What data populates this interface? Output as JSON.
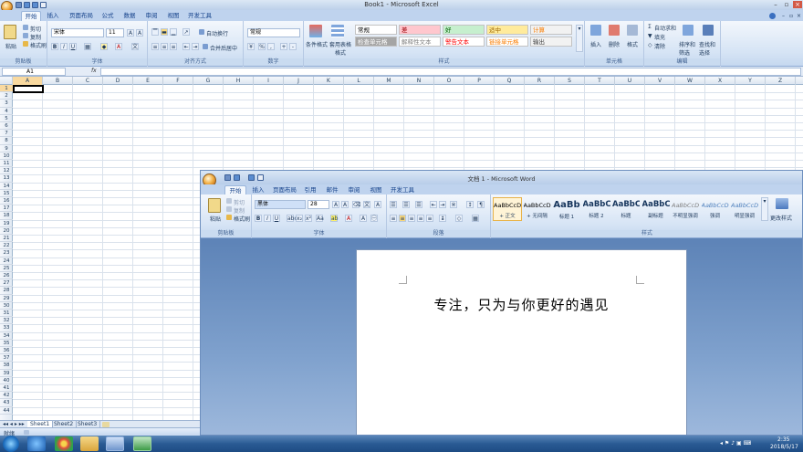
{
  "excel": {
    "title": "Book1 - Microsoft Excel",
    "tabs": [
      "开始",
      "插入",
      "页面布局",
      "公式",
      "数据",
      "审阅",
      "视图",
      "开发工具"
    ],
    "active_tab": "开始",
    "clipboard": {
      "paste": "粘贴",
      "cut": "剪切",
      "copy": "复制",
      "format_painter": "格式刷",
      "label": "剪贴板"
    },
    "font": {
      "name": "宋体",
      "size": "11",
      "label": "字体"
    },
    "alignment": {
      "wrap": "自动换行",
      "merge": "合并后居中",
      "label": "对齐方式"
    },
    "number": {
      "format": "常规",
      "label": "数字"
    },
    "styles": {
      "conditional": "条件格式",
      "table": "套用表格格式",
      "cells": [
        {
          "text": "常规",
          "bg": "#ffffff",
          "fg": "#000000"
        },
        {
          "text": "差",
          "bg": "#ffc7ce",
          "fg": "#9c0006"
        },
        {
          "text": "好",
          "bg": "#c6efce",
          "fg": "#006100"
        },
        {
          "text": "适中",
          "bg": "#ffeb9c",
          "fg": "#9c6500"
        },
        {
          "text": "计算",
          "bg": "#f2f2f2",
          "fg": "#fa7d00"
        },
        {
          "text": "检查单元格",
          "bg": "#a5a5a5",
          "fg": "#ffffff"
        },
        {
          "text": "解释性文本",
          "bg": "#ffffff",
          "fg": "#7f7f7f"
        },
        {
          "text": "警告文本",
          "bg": "#ffffff",
          "fg": "#ff0000"
        },
        {
          "text": "链接单元格",
          "bg": "#ffffff",
          "fg": "#fa7d00"
        },
        {
          "text": "输出",
          "bg": "#f2f2f2",
          "fg": "#3f3f3f"
        }
      ],
      "label": "样式"
    },
    "cells_group": {
      "insert": "插入",
      "delete": "删除",
      "format": "格式",
      "label": "单元格"
    },
    "editing": {
      "autosum": "自动求和",
      "fill": "填充",
      "clear": "清除",
      "sort": "排序和筛选",
      "find": "查找和选择",
      "label": "编辑"
    },
    "name_box": "A1",
    "fx": "fx",
    "columns": [
      "A",
      "B",
      "C",
      "D",
      "E",
      "F",
      "G",
      "H",
      "I",
      "J",
      "K",
      "L",
      "M",
      "N",
      "O",
      "P",
      "Q",
      "R",
      "S",
      "T",
      "U",
      "V",
      "W",
      "X",
      "Y",
      "Z"
    ],
    "rows": [
      "1",
      "2",
      "3",
      "4",
      "5",
      "6",
      "7",
      "8",
      "9",
      "10",
      "11",
      "12",
      "13",
      "14",
      "15",
      "16",
      "17",
      "18",
      "19",
      "20",
      "21",
      "22",
      "23",
      "24",
      "25",
      "26",
      "27",
      "28",
      "29",
      "30",
      "31",
      "32",
      "33",
      "34",
      "35",
      "36",
      "37",
      "38",
      "39",
      "40",
      "41",
      "42",
      "43",
      "44"
    ],
    "sheets": [
      "Sheet1",
      "Sheet2",
      "Sheet3"
    ],
    "status": "就绪"
  },
  "word": {
    "title": "文档 1 - Microsoft Word",
    "tabs": [
      "开始",
      "插入",
      "页面布局",
      "引用",
      "邮件",
      "审阅",
      "视图",
      "开发工具"
    ],
    "active_tab": "开始",
    "clipboard": {
      "paste": "粘贴",
      "cut": "剪切",
      "copy": "复制",
      "format_painter": "格式刷",
      "label": "剪贴板"
    },
    "font": {
      "name": "黑体",
      "size": "28",
      "label": "字体"
    },
    "paragraph_label": "段落",
    "styles": [
      {
        "preview": "AaBbCcDd",
        "name": "+ 正文"
      },
      {
        "preview": "AaBbCcDd",
        "name": "+ 无间隔"
      },
      {
        "preview": "AaBb",
        "name": "标题 1"
      },
      {
        "preview": "AaBbC",
        "name": "标题 2"
      },
      {
        "preview": "AaBbC",
        "name": "标题"
      },
      {
        "preview": "AaBbC",
        "name": "副标题"
      },
      {
        "preview": "AaBbCcDd",
        "name": "不明显强调"
      },
      {
        "preview": "AaBbCcDd",
        "name": "强调"
      },
      {
        "preview": "AaBbCcDd",
        "name": "明显强调"
      }
    ],
    "change_styles": "更改样式",
    "styles_label": "样式",
    "document_text": "专注，只为与你更好的遇见"
  },
  "taskbar": {
    "time": "2:35",
    "date": "2018/5/17"
  }
}
